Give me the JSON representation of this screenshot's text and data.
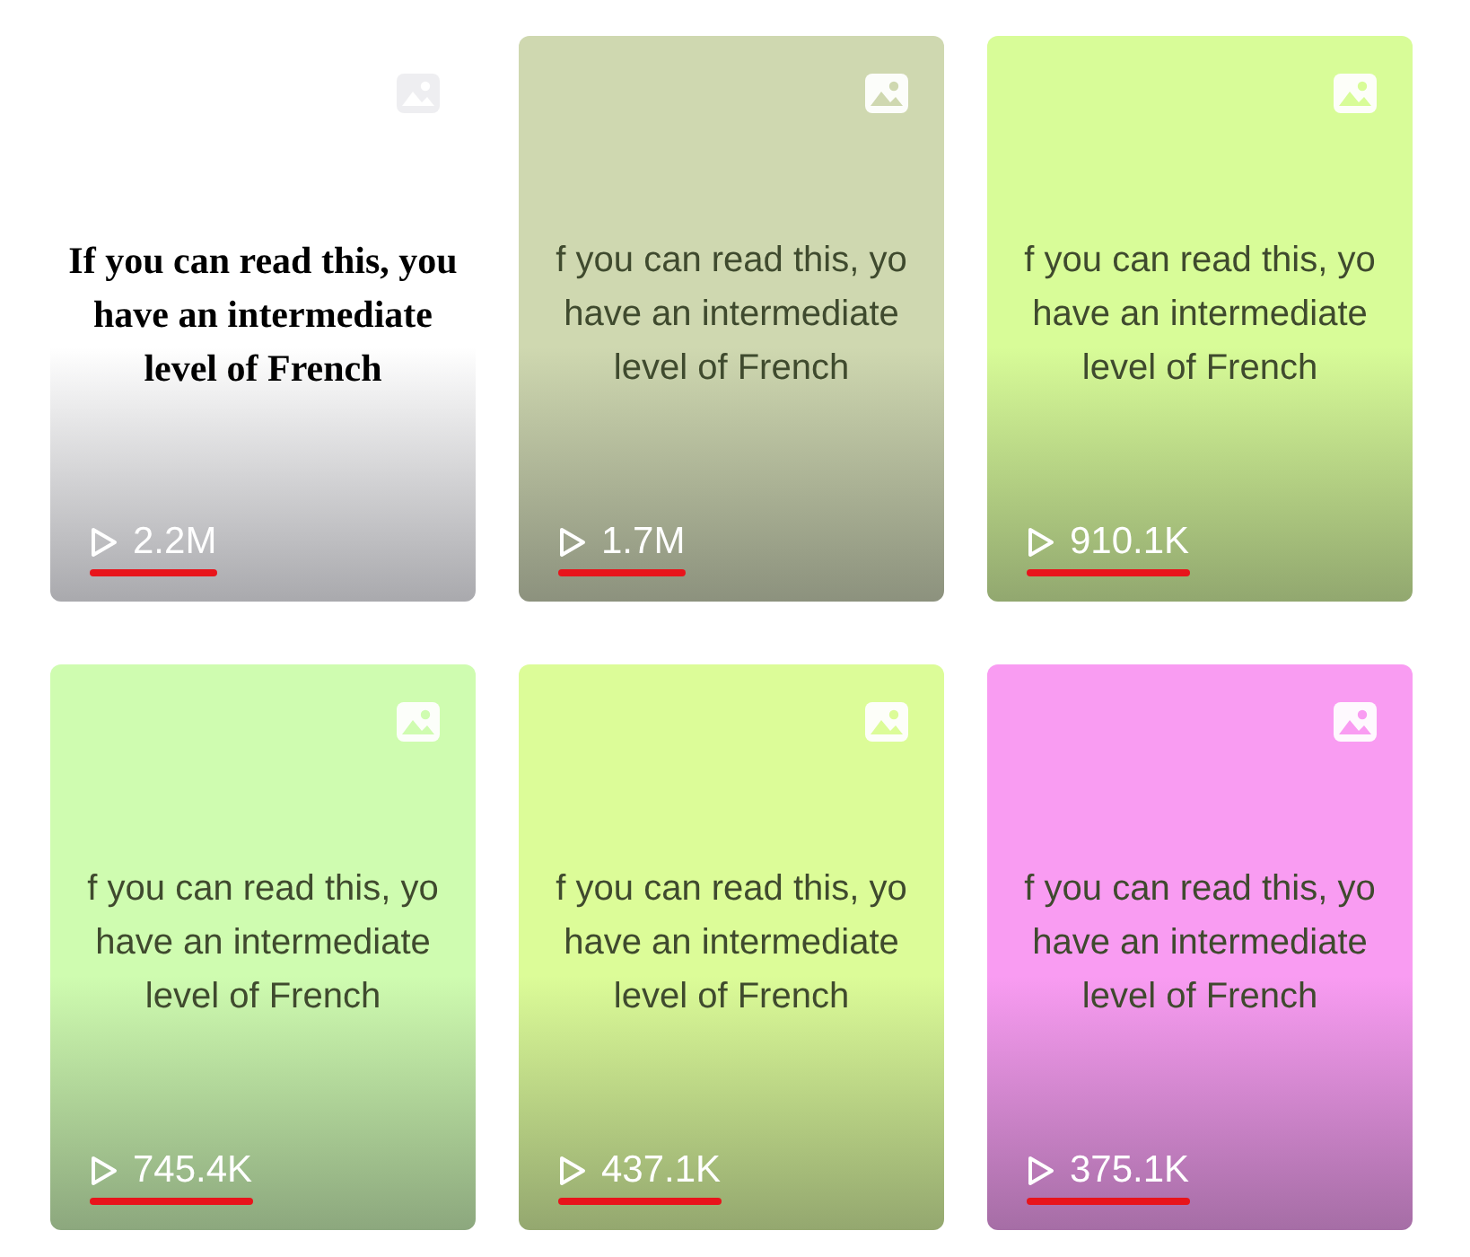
{
  "videos": [
    {
      "kind": "bold-serif",
      "color": "#ffffff",
      "caption": [
        "If you can read this, you",
        "have an intermediate",
        "level of French"
      ],
      "views": "2.2M",
      "underlined": true
    },
    {
      "kind": "plain",
      "color": "#cfd8b0",
      "caption": [
        "f you can read this, yo",
        "have an intermediate",
        "level of French"
      ],
      "views": "1.7M",
      "underlined": true
    },
    {
      "kind": "plain",
      "color": "#d8fc98",
      "caption": [
        "f you can read this, yo",
        "have an intermediate",
        "level of French"
      ],
      "views": "910.1K",
      "underlined": true
    },
    {
      "kind": "plain",
      "color": "#cffcb0",
      "caption": [
        "f you can read this, yo",
        "have an intermediate",
        "level of French"
      ],
      "views": "745.4K",
      "underlined": true
    },
    {
      "kind": "plain",
      "color": "#dcfc98",
      "caption": [
        "f you can read this, yo",
        "have an intermediate",
        "level of French"
      ],
      "views": "437.1K",
      "underlined": true
    },
    {
      "kind": "plain",
      "color": "#f99cf2",
      "caption": [
        "f you can read this, yo",
        "have an intermediate",
        "level of French"
      ],
      "views": "375.1K",
      "underlined": true
    }
  ]
}
